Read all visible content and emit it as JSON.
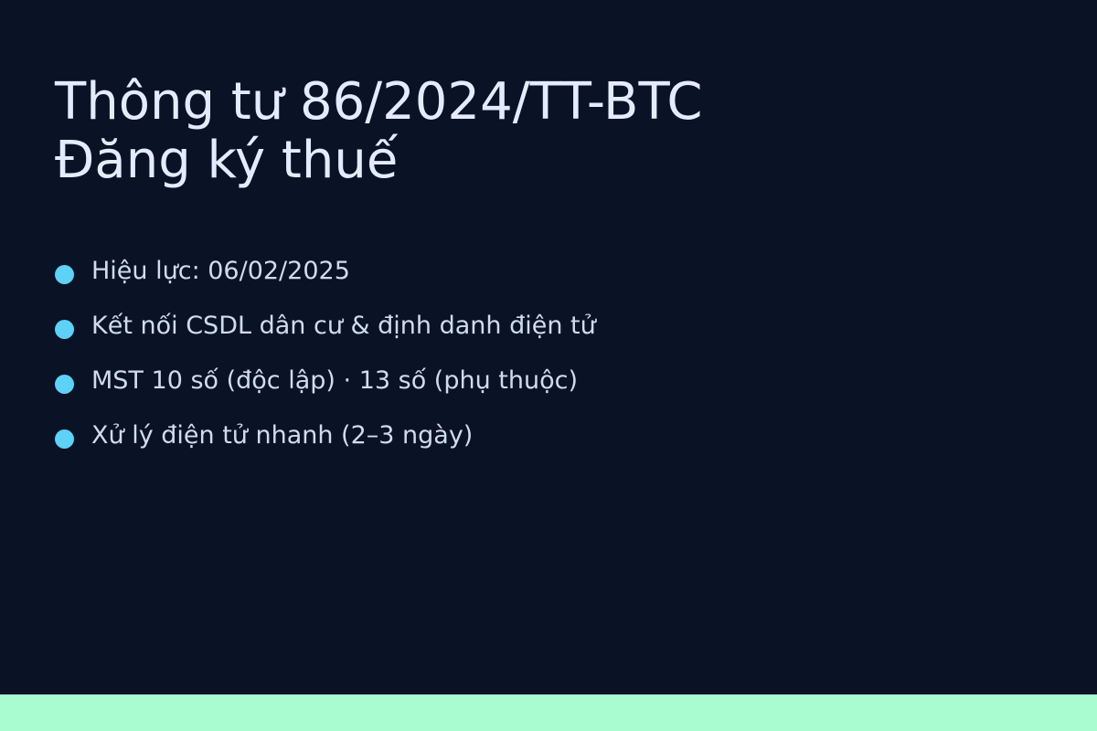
{
  "slide": {
    "title_line_1": "Thông tư 86/2024/TT-BTC",
    "title_line_2": "Đăng ký thuế",
    "bullets": [
      "Hiệu lực: 06/02/2025",
      "Kết nối CSDL dân cư & định danh điện tử",
      "MST 10 số (độc lập) · 13 số (phụ thuộc)",
      "Xử lý điện tử nhanh (2–3 ngày)"
    ]
  },
  "colors": {
    "background": "#0a1326",
    "title": "#e3ecff",
    "bullet_text": "#cfdcef",
    "bullet_dot": "#5ed1f7",
    "footer_bar": "#a8fcd0"
  }
}
